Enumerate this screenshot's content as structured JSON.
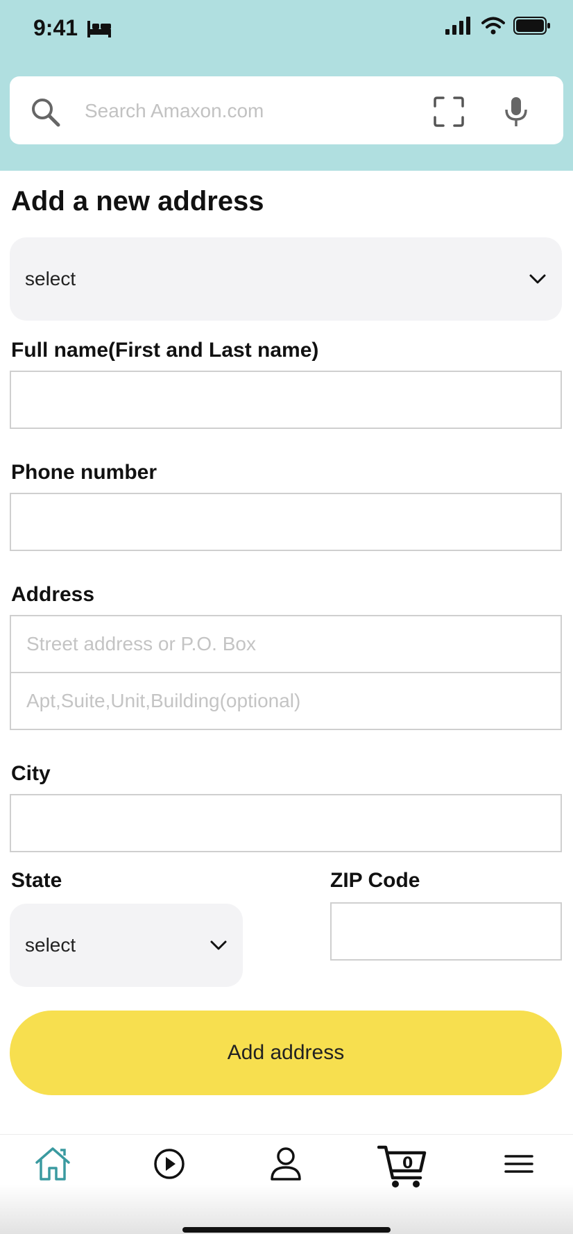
{
  "status_bar": {
    "time": "9:41"
  },
  "search": {
    "placeholder": "Search Amaxon.com"
  },
  "page": {
    "title": "Add a new address"
  },
  "form": {
    "country_select_value": "select",
    "full_name_label": "Full name(First and Last name)",
    "phone_label": "Phone number",
    "address_label": "Address",
    "street_placeholder": "Street address or P.O. Box",
    "apt_placeholder": "Apt,Suite,Unit,Building(optional)",
    "city_label": "City",
    "state_label": "State",
    "state_select_value": "select",
    "zip_label": "ZIP Code",
    "submit_label": "Add address"
  },
  "bottom_nav": {
    "items": [
      {
        "icon": "home-icon",
        "active": true
      },
      {
        "icon": "play-icon",
        "active": false
      },
      {
        "icon": "user-icon",
        "active": false
      },
      {
        "icon": "cart-icon",
        "active": false,
        "badge": "0"
      },
      {
        "icon": "menu-icon",
        "active": false
      }
    ]
  },
  "colors": {
    "header_bg": "#b0dfe0",
    "accent_button": "#f7df4f",
    "active_nav": "#3a9aa0",
    "select_bg": "#f3f3f5"
  }
}
